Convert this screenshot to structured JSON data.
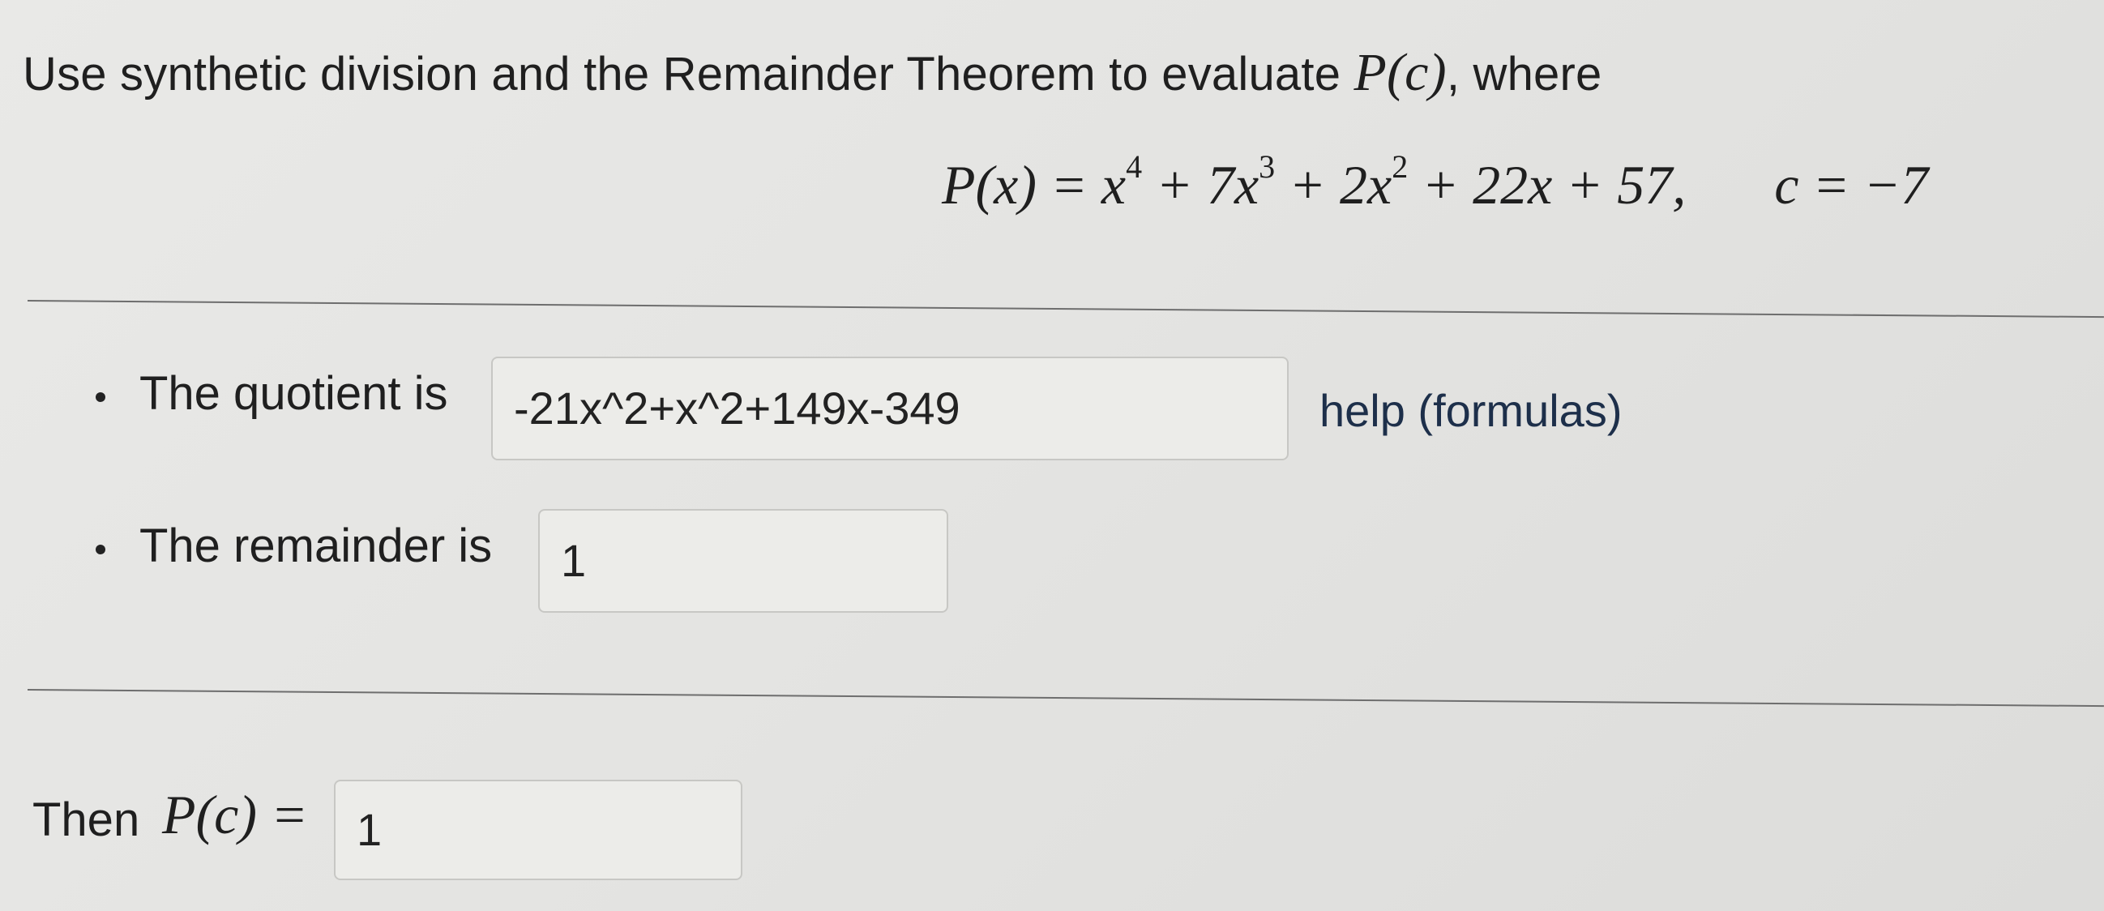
{
  "question": {
    "prefix": "Use synthetic division and the Remainder Theorem to evaluate",
    "func_c": "P(c)",
    "suffix": ", where"
  },
  "equation": {
    "polynomial_lhs": "P(x) = x",
    "polynomial_rest": [
      {
        "exp": "4",
        "text": " + 7x"
      },
      {
        "exp": "3",
        "text": " + 2x"
      },
      {
        "exp": "2",
        "text": " + 22x + 57,"
      }
    ],
    "c_value": "c = −7"
  },
  "quotient": {
    "label": "The quotient is",
    "value": "-21x^2+x^2+149x-349",
    "help_link": "help (formulas)"
  },
  "remainder": {
    "label": "The remainder is",
    "value": "1"
  },
  "result": {
    "label": "Then",
    "func": "P(c) =",
    "value": "1"
  }
}
